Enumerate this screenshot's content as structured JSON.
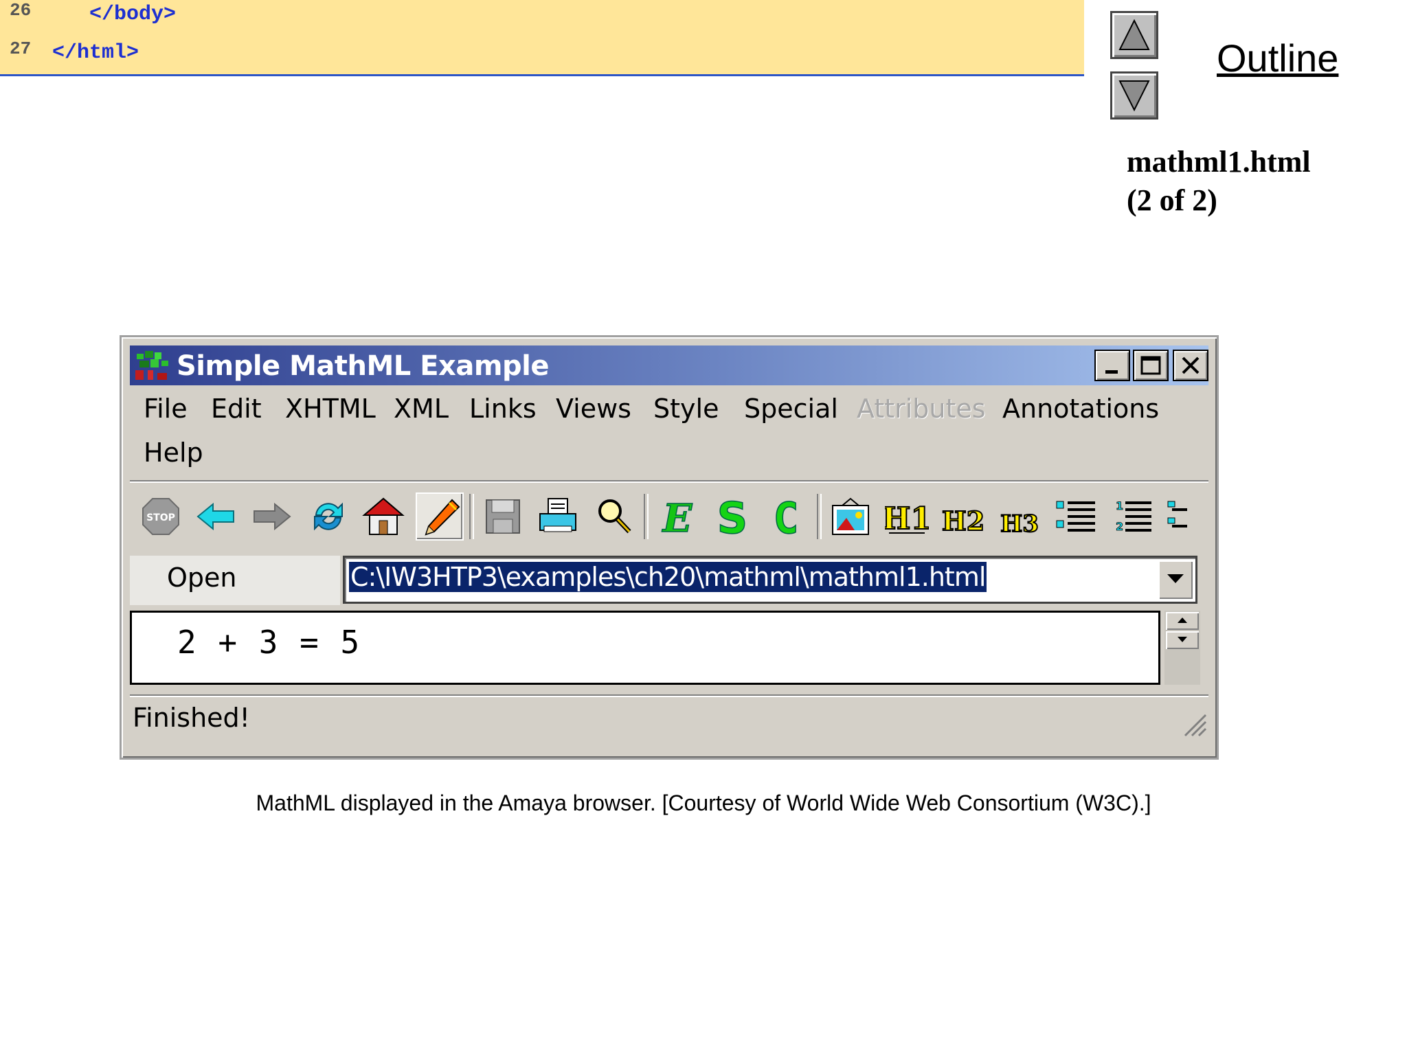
{
  "code": {
    "lines": [
      {
        "number": "26",
        "text": "</body>"
      },
      {
        "number": "27",
        "text": "</html>"
      }
    ]
  },
  "outline": {
    "label": "Outline",
    "file_name": "mathml1.html",
    "page_info": "(2 of 2)"
  },
  "window": {
    "title": "Simple MathML Example",
    "controls": [
      "minimize",
      "maximize",
      "close"
    ],
    "menu": [
      "File",
      "Edit",
      "XHTML",
      "XML",
      "Links",
      "Views",
      "Style",
      "Special",
      "Attributes",
      "Annotations",
      "Help"
    ],
    "disabled_menu": [
      "Attributes"
    ],
    "toolbar_icons": [
      "stop-icon",
      "back-arrow-icon",
      "forward-arrow-icon",
      "reload-icon",
      "home-icon",
      "edit-pencil-icon",
      "save-icon",
      "print-icon",
      "find-icon",
      "emphasis-E-icon",
      "strong-S-icon",
      "code-C-icon",
      "image-icon",
      "h1-icon",
      "h2-icon",
      "h3-icon",
      "bullet-list-icon",
      "numbered-list-icon",
      "definition-list-icon"
    ],
    "open_label": "Open",
    "url": "C:\\IW3HTP3\\examples\\ch20\\mathml\\mathml1.html",
    "content": "2 + 3 = 5",
    "status": "Finished!"
  },
  "caption": "MathML displayed in the Amaya browser. [Courtesy of World Wide Web Consortium (W3C).]",
  "colors": {
    "code_background": "#ffe699",
    "code_text": "#1d2fd1",
    "title_gradient_start": "#2f3f8f",
    "title_gradient_end": "#a7c3ee",
    "url_selection": "#0a246a"
  }
}
